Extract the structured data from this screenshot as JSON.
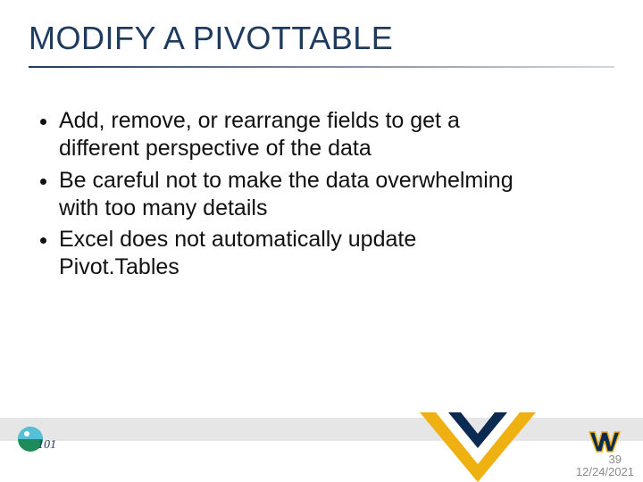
{
  "title": "MODIFY A PIVOTTABLE",
  "bullets": [
    "Add, remove, or rearrange fields to get a different perspective of the data",
    "Be careful not to make the data overwhelming with too many details",
    "Excel does not automatically update Pivot.Tables"
  ],
  "page_number": "39",
  "date": "12/24/2021",
  "colors": {
    "title": "#1f3a5f",
    "accent_gold": "#eeb111",
    "accent_navy": "#0a2a52"
  }
}
